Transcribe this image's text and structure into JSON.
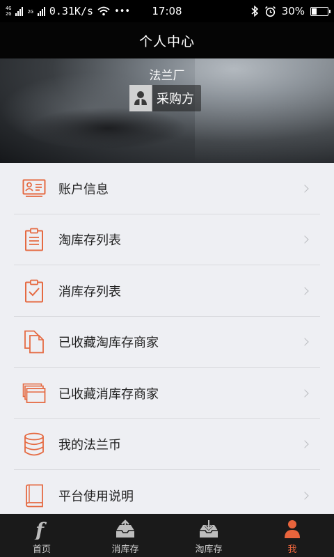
{
  "status_bar": {
    "network_top": "4G",
    "network_bottom": "2G",
    "network_mid": "2G",
    "speed": "0.31K/s",
    "dots": "•••",
    "time": "17:08",
    "battery": "30%",
    "battery_level": 0.3
  },
  "header": {
    "title": "个人中心"
  },
  "profile": {
    "company": "法兰厂",
    "role": "采购方"
  },
  "menu": {
    "items": [
      {
        "label": "账户信息",
        "icon": "account-card-icon"
      },
      {
        "label": "淘库存列表",
        "icon": "clipboard-list-icon"
      },
      {
        "label": "消库存列表",
        "icon": "clipboard-check-icon"
      },
      {
        "label": "已收藏淘库存商家",
        "icon": "documents-icon"
      },
      {
        "label": "已收藏消库存商家",
        "icon": "stacked-cards-icon"
      },
      {
        "label": "我的法兰币",
        "icon": "coins-stack-icon"
      },
      {
        "label": "平台使用说明",
        "icon": "book-icon"
      }
    ]
  },
  "tabs": [
    {
      "label": "首页",
      "icon": "home-f-icon",
      "active": false
    },
    {
      "label": "消库存",
      "icon": "upload-tray-icon",
      "active": false
    },
    {
      "label": "淘库存",
      "icon": "download-tray-icon",
      "active": false
    },
    {
      "label": "我",
      "icon": "person-icon",
      "active": true
    }
  ],
  "colors": {
    "accent": "#e8643c",
    "icon_stroke": "#e56a42",
    "background": "#eeeff3",
    "tab_bar": "#1a1a1a"
  }
}
